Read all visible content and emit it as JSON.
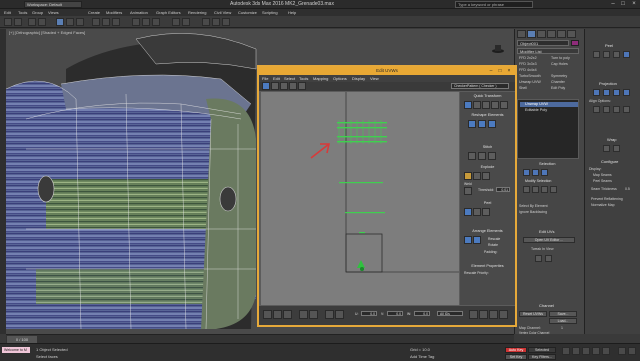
{
  "title_bar": {
    "app_title": "Autodesk 3ds Max 2016     MK2_Grenade03.max",
    "workspace": "Workspace: Default",
    "search_placeholder": "Type a keyword or phrase"
  },
  "menu": [
    "Edit",
    "Tools",
    "Group",
    "Views",
    "Create",
    "Modifiers",
    "Animation",
    "Graph Editors",
    "Rendering",
    "Civil View",
    "Customize",
    "Scripting",
    "Help"
  ],
  "viewport": {
    "label": "[+] [Orthographic] [Shaded + Edged Faces]"
  },
  "modifier_panel": {
    "object_name": "Object001",
    "object_color": "#8f2c7a",
    "modifier_list_label": "Modifier List",
    "quick_buttons": [
      "FFD 2x2x2",
      "Turn to poly",
      "FFD 3x3x3",
      "Cap Holes",
      "FFD 4x4x4",
      "TurboSmooth",
      "Symmetry",
      "Unwrap UVW",
      "Chamfer",
      "Shell",
      "Edit Poly"
    ],
    "stack": [
      {
        "label": "Unwrap UVW",
        "selected": true
      },
      {
        "label": "Editable Poly",
        "selected": false
      }
    ],
    "selection_title": "Selection",
    "modify_selection_title": "Modify Selection",
    "select_by_element": "Select By Element",
    "ignore_backfacing": "Ignore Backfacing",
    "edit_uvs_title": "Edit UVs",
    "open_uv_editor": "Open UV Editor ...",
    "tweak_in_view": "Tweak In View",
    "channel_title": "Channel",
    "reset_uvws": "Reset UVWs",
    "save": "Save...",
    "load": "Load...",
    "map_channel": "Map Channel:",
    "map_channel_value": "1",
    "vertex_color_channel": "Vertex Color Channel"
  },
  "far_right_panel": {
    "peel_title": "Peel",
    "projection_title": "Projection",
    "align_options": "Align Options:",
    "wrap_title": "Wrap",
    "configure_title": "Configure",
    "display_title": "Display:",
    "map_seams": "Map Seams",
    "peel_seams": "Peel Seams",
    "seam_thickness": "Seam Thickness",
    "seam_thickness_value": "0.5",
    "prevent_reflattening": "Prevent Reflattening",
    "normalize_map": "Normalize Map"
  },
  "uv_editor": {
    "title": "Edit UVWs",
    "menu": [
      "File",
      "Edit",
      "Select",
      "Tools",
      "Mapping",
      "Options",
      "Display",
      "View"
    ],
    "texture_dropdown": "CheckerPattern ( Checker )",
    "sections": [
      "Quick Transform",
      "Reshape Elements",
      "Stitch",
      "Explode",
      "Weld",
      "Peel",
      "Arrange Elements",
      "Element Properties"
    ],
    "padding_label": "Padding:",
    "threshold_label": "Threshold:",
    "threshold_value": "0.01",
    "rescale_label": "Rescale",
    "rotate_label": "Rotate",
    "group_label": "Rescale Priority:",
    "bottom_field": "All IDs",
    "u_value": "0.0",
    "v_value": "0.0",
    "w_value": "0.0"
  },
  "timeline": {
    "slider": "0 / 100"
  },
  "status_bar": {
    "maxscript": "Welcome to M",
    "selected": "1 Object Selected",
    "prompt": "Select faces",
    "grid": "Grid = 10.0",
    "auto_key": "Auto Key",
    "selected_key": "Selected",
    "set_key": "Set Key",
    "key_filters": "Key Filters...",
    "add_time_tag": "Add Time Tag"
  }
}
